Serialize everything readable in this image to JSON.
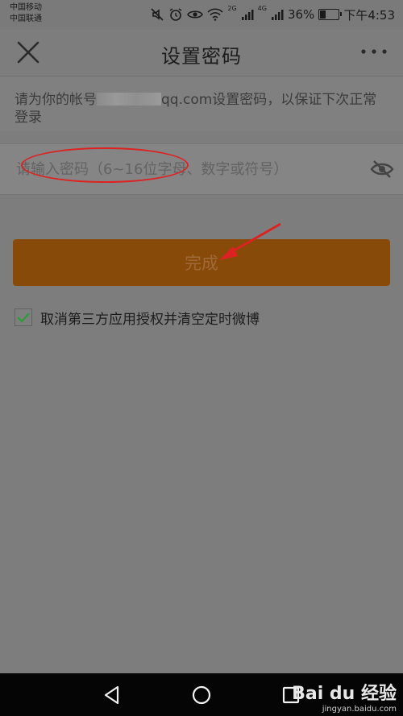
{
  "status_bar": {
    "carrier1": "中国移动",
    "carrier2": "中国联通",
    "net1": "2G",
    "net2": "4G",
    "battery": "36%",
    "battery_level": 0.36,
    "time": "下午4:53"
  },
  "nav": {
    "title": "设置密码",
    "close_icon": "close-icon",
    "more_icon": "more-icon"
  },
  "notice": {
    "prefix": "请为你的帐号",
    "suffix": "qq.com设置密码，以保证下次正常登录"
  },
  "password": {
    "placeholder": "请输入密码（6~16位字母、数字或符号）",
    "value": "",
    "toggle_icon": "eye-off-icon"
  },
  "done_button": {
    "label": "完成"
  },
  "checkbox": {
    "checked": true,
    "label": "取消第三方应用授权并清空定时微博"
  },
  "watermark": {
    "brand": "Bai du 经验",
    "url": "jingyan.baidu.com"
  },
  "colors": {
    "overlay": "#7d7d7d",
    "button": "#874a08",
    "check": "#2e9b3e",
    "annotation": "#dd2222"
  }
}
